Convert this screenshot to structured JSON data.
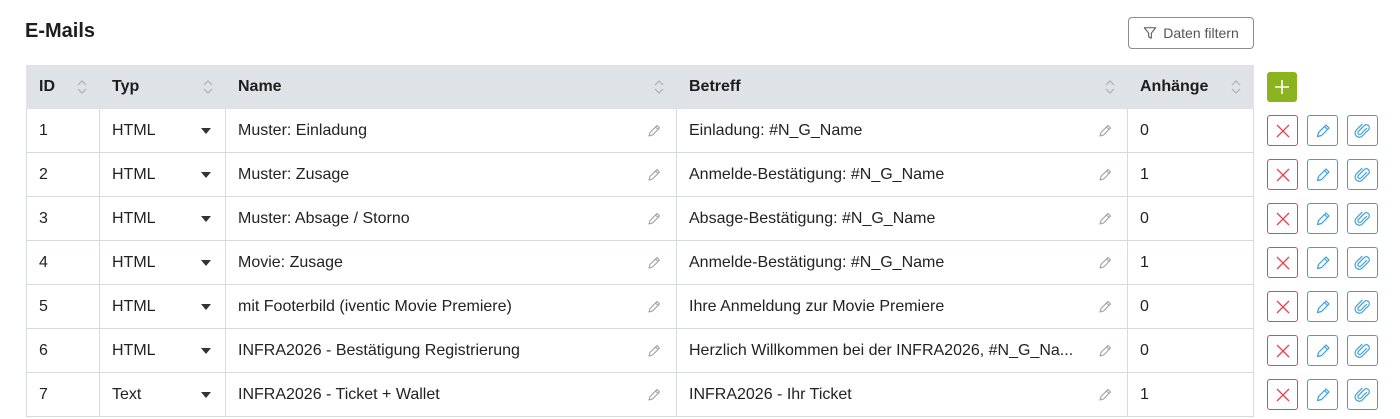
{
  "page": {
    "title": "E-Mails"
  },
  "toolbar": {
    "filter_label": "Daten filtern"
  },
  "table": {
    "headers": {
      "id": "ID",
      "type": "Typ",
      "name": "Name",
      "subject": "Betreff",
      "attachments": "Anhänge"
    },
    "rows": [
      {
        "id": "1",
        "type": "HTML",
        "name": "Muster: Einladung",
        "subject": "Einladung: #N_G_Name",
        "attachments": "0"
      },
      {
        "id": "2",
        "type": "HTML",
        "name": "Muster: Zusage",
        "subject": "Anmelde-Bestätigung: #N_G_Name",
        "attachments": "1"
      },
      {
        "id": "3",
        "type": "HTML",
        "name": "Muster: Absage / Storno",
        "subject": "Absage-Bestätigung: #N_G_Name",
        "attachments": "0"
      },
      {
        "id": "4",
        "type": "HTML",
        "name": "Movie: Zusage",
        "subject": "Anmelde-Bestätigung: #N_G_Name",
        "attachments": "1"
      },
      {
        "id": "5",
        "type": "HTML",
        "name": "mit Footerbild (iventic Movie Premiere)",
        "subject": "Ihre Anmeldung zur Movie Premiere",
        "attachments": "0"
      },
      {
        "id": "6",
        "type": "HTML",
        "name": "INFRA2026 - Bestätigung Registrierung",
        "subject": "Herzlich Willkommen bei der INFRA2026, #N_G_Na...",
        "attachments": "0"
      },
      {
        "id": "7",
        "type": "Text",
        "name": "INFRA2026 - Ticket + Wallet",
        "subject": "INFRA2026 - Ihr Ticket",
        "attachments": "1"
      }
    ]
  },
  "icons": {
    "filter": "filter-icon",
    "sort": "sort-icon",
    "dropdown": "chevron-down-icon",
    "edit_cell": "pencil-icon",
    "add": "plus-icon",
    "delete": "close-icon",
    "edit": "pencil-icon",
    "attach": "paperclip-icon"
  },
  "colors": {
    "header_bg": "#dfe3e7",
    "add_green": "#8ab31f",
    "delete_red": "#e9434f",
    "action_blue": "#3d9fd9"
  }
}
